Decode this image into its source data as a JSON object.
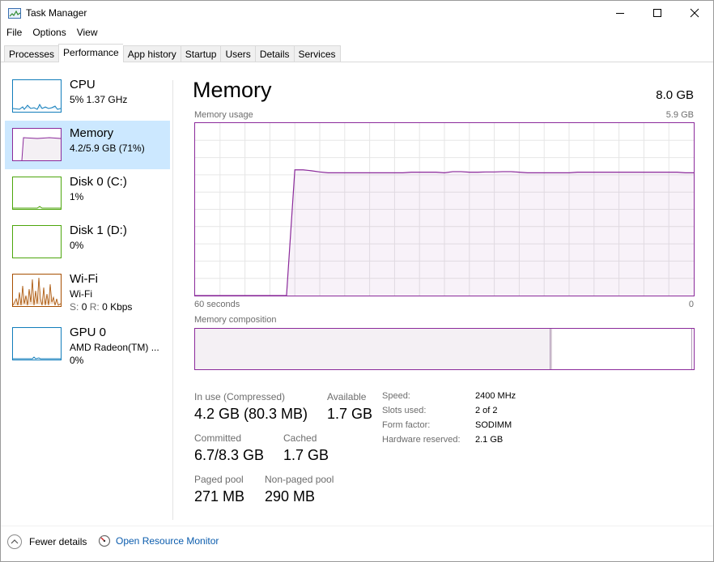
{
  "window": {
    "title": "Task Manager",
    "icon": "task-manager-icon"
  },
  "menu": {
    "file": "File",
    "options": "Options",
    "view": "View"
  },
  "tabs": [
    "Processes",
    "Performance",
    "App history",
    "Startup",
    "Users",
    "Details",
    "Services"
  ],
  "active_tab": "Performance",
  "sidebar": {
    "cpu": {
      "title": "CPU",
      "sub": "5%  1.37 GHz",
      "usage_percent": 5,
      "color": "#117dbb"
    },
    "memory": {
      "title": "Memory",
      "sub": "4.2/5.9 GB (71%)",
      "usage_percent": 71,
      "color": "#8b2a9b"
    },
    "disk0": {
      "title": "Disk 0 (C:)",
      "sub": "1%",
      "usage_percent": 1,
      "color": "#4da60c"
    },
    "disk1": {
      "title": "Disk 1 (D:)",
      "sub": "0%",
      "usage_percent": 0,
      "color": "#4da60c"
    },
    "wifi": {
      "title": "Wi-Fi",
      "sub": "Wi-Fi",
      "send_label": "S:",
      "send": "0",
      "recv_label": "R:",
      "recv": "0 Kbps",
      "color": "#a74f01"
    },
    "gpu": {
      "title": "GPU 0",
      "sub": "AMD Radeon(TM) ...",
      "sub2": "0%",
      "usage_percent": 0,
      "color": "#117dbb"
    }
  },
  "main": {
    "title": "Memory",
    "total": "8.0 GB",
    "usage_label": "Memory usage",
    "usage_max": "5.9 GB",
    "time_left": "60 seconds",
    "time_right": "0",
    "composition_label": "Memory composition",
    "accent_color": "#8b2a9b"
  },
  "memory_history": {
    "unit": "GB",
    "max": 5.9,
    "values": [
      0,
      0,
      0,
      0,
      0,
      0,
      0,
      0,
      0,
      0,
      0,
      0,
      4.3,
      4.3,
      4.27,
      4.23,
      4.2,
      4.2,
      4.2,
      4.2,
      4.2,
      4.2,
      4.2,
      4.2,
      4.2,
      4.2,
      4.22,
      4.22,
      4.22,
      4.22,
      4.2,
      4.24,
      4.24,
      4.22,
      4.22,
      4.23,
      4.23,
      4.24,
      4.24,
      4.22,
      4.2,
      4.2,
      4.2,
      4.2,
      4.2,
      4.2,
      4.22,
      4.22,
      4.22,
      4.22,
      4.22,
      4.22,
      4.22,
      4.22,
      4.22,
      4.22,
      4.22,
      4.22,
      4.22,
      4.2,
      4.2
    ]
  },
  "composition": {
    "in_use_fraction": 0.712,
    "modified_fraction": 0.004,
    "standby_fraction": 0.285
  },
  "stats": {
    "in_use_label": "In use (Compressed)",
    "in_use_value": "4.2 GB (80.3 MB)",
    "available_label": "Available",
    "available_value": "1.7 GB",
    "committed_label": "Committed",
    "committed_value": "6.7/8.3 GB",
    "cached_label": "Cached",
    "cached_value": "1.7 GB",
    "paged_label": "Paged pool",
    "paged_value": "271 MB",
    "nonpaged_label": "Non-paged pool",
    "nonpaged_value": "290 MB"
  },
  "info": {
    "speed_label": "Speed:",
    "speed_value": "2400 MHz",
    "slots_label": "Slots used:",
    "slots_value": "2 of 2",
    "form_label": "Form factor:",
    "form_value": "SODIMM",
    "reserved_label": "Hardware reserved:",
    "reserved_value": "2.1 GB"
  },
  "footer": {
    "fewer_details": "Fewer details",
    "open_resmon": "Open Resource Monitor"
  }
}
